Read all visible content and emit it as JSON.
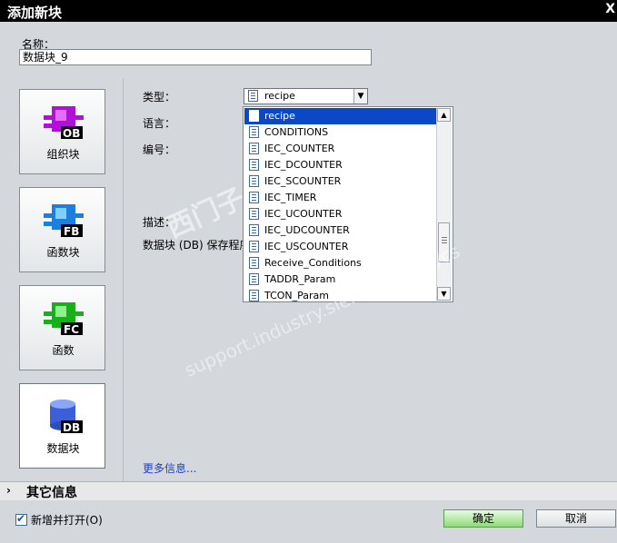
{
  "window": {
    "title": "添加新块",
    "close": "X"
  },
  "name": {
    "label": "名称：",
    "value": "数据块_9"
  },
  "blocks": [
    {
      "label": "组织块",
      "code": "OB",
      "color": "#b010d8"
    },
    {
      "label": "函数块",
      "code": "FB",
      "color": "#1a7fe0"
    },
    {
      "label": "函数",
      "code": "FC",
      "color": "#18b018"
    },
    {
      "label": "数据块",
      "code": "DB",
      "color": "#3a5fd8"
    }
  ],
  "form": {
    "type_label": "类型：",
    "language_label": "语言：",
    "number_label": "编号：",
    "description_label": "描述：",
    "retention_label": "数据块 (DB) 保存程序",
    "type_value": "recipe"
  },
  "dropdown": {
    "items": [
      "recipe",
      "CONDITIONS",
      "IEC_COUNTER",
      "IEC_DCOUNTER",
      "IEC_SCOUNTER",
      "IEC_TIMER",
      "IEC_UCOUNTER",
      "IEC_UDCOUNTER",
      "IEC_USCOUNTER",
      "Receive_Conditions",
      "TADDR_Param",
      "TCON_Param"
    ],
    "selected": "recipe"
  },
  "more_info": "更多信息...",
  "other_info": "其它信息",
  "footer": {
    "add_and_open": "新增并打开(O)",
    "ok": "确定",
    "cancel": "取消"
  },
  "watermark": {
    "line1": "西门子",
    "line2": "support.industry.siemens.com/cs"
  }
}
